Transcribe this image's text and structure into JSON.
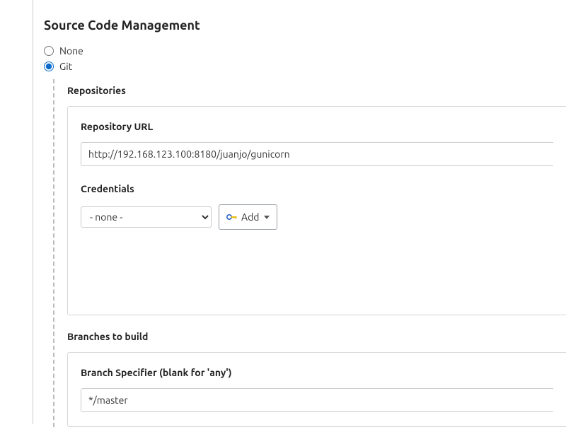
{
  "section": {
    "title": "Source Code Management"
  },
  "scm": {
    "options": {
      "none": {
        "label": "None",
        "selected": false
      },
      "git": {
        "label": "Git",
        "selected": true
      }
    }
  },
  "git": {
    "repositories": {
      "label": "Repositories",
      "repo_url": {
        "label": "Repository URL",
        "value": "http://192.168.123.100:8180/juanjo/gunicorn"
      },
      "credentials": {
        "label": "Credentials",
        "selected": "- none -",
        "add_label": "Add"
      }
    },
    "branches": {
      "label": "Branches to build",
      "branch_specifier": {
        "label": "Branch Specifier (blank for 'any')",
        "value": "*/master"
      }
    }
  }
}
